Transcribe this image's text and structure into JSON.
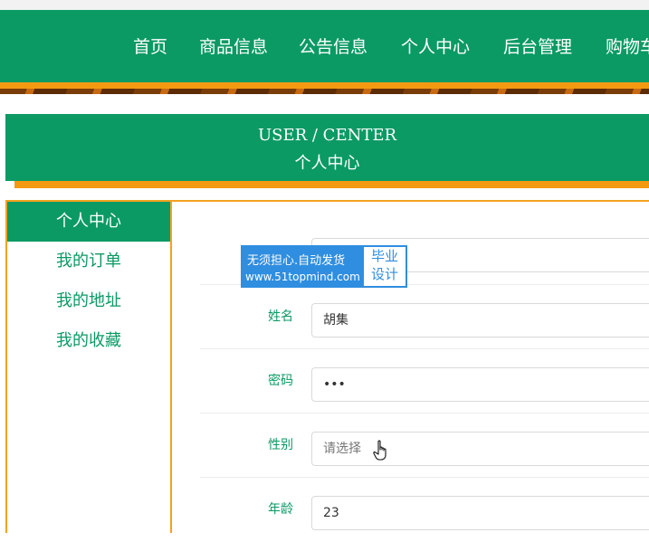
{
  "nav": {
    "items": [
      "首页",
      "商品信息",
      "公告信息",
      "个人中心",
      "后台管理",
      "购物车"
    ]
  },
  "page_header": {
    "en": "USER / CENTER",
    "cn": "个人中心"
  },
  "sidebar": {
    "items": [
      {
        "label": "个人中心",
        "active": true
      },
      {
        "label": "我的订单",
        "active": false
      },
      {
        "label": "我的地址",
        "active": false
      },
      {
        "label": "我的收藏",
        "active": false
      }
    ]
  },
  "form": {
    "fields": [
      {
        "label": "",
        "value": "",
        "placeholder": ""
      },
      {
        "label": "姓名",
        "value": "胡集",
        "placeholder": ""
      },
      {
        "label": "密码",
        "value": "•••",
        "placeholder": ""
      },
      {
        "label": "性别",
        "value": "",
        "placeholder": "请选择"
      },
      {
        "label": "年龄",
        "value": "23",
        "placeholder": ""
      }
    ]
  },
  "watermark": {
    "line1": "无须担心.自动发货",
    "line2": "www.51topmind.com",
    "right1": "毕业",
    "right2": "设计"
  },
  "colors": {
    "primary_green": "#0b9a64",
    "accent_orange": "#f49a12",
    "watermark_blue": "#2f8ee0"
  }
}
